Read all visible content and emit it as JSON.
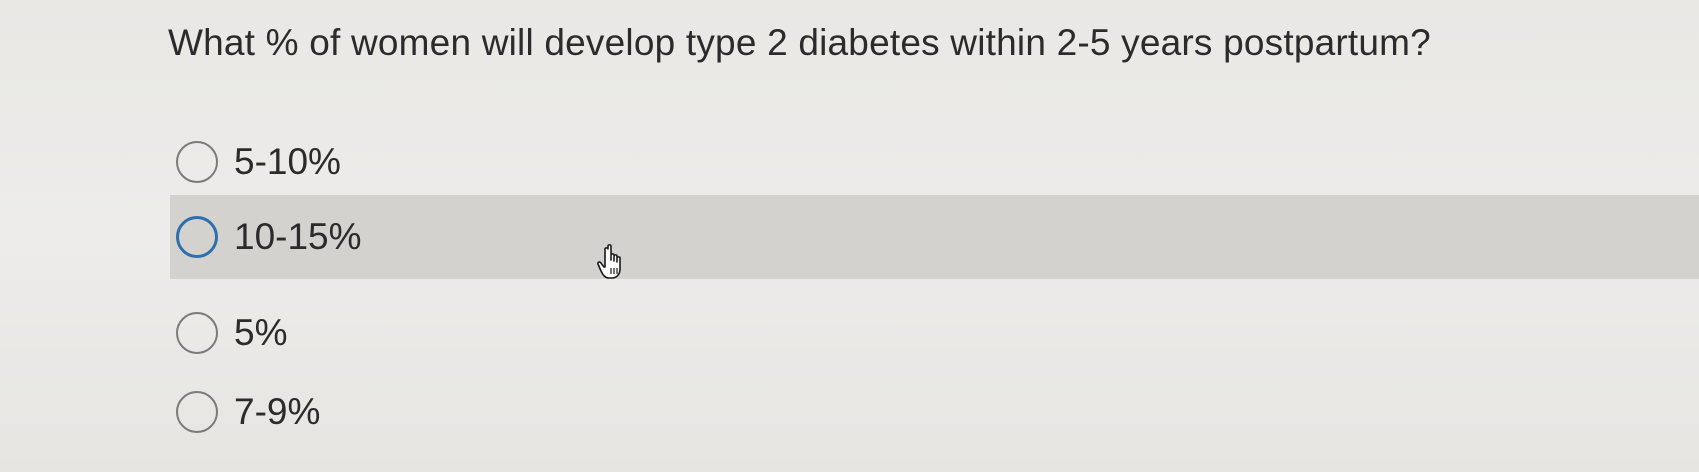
{
  "question": {
    "text": "What % of women will develop type 2 diabetes within 2-5 years postpartum?"
  },
  "options": [
    {
      "label": "5-10%",
      "selected": false,
      "hovered": false
    },
    {
      "label": "10-15%",
      "selected": false,
      "hovered": true
    },
    {
      "label": "5%",
      "selected": false,
      "hovered": false
    },
    {
      "label": "7-9%",
      "selected": false,
      "hovered": false
    }
  ],
  "colors": {
    "background": "#ecebe8",
    "hover_row": "#d3d2ce",
    "radio_border": "#7a7a7a",
    "radio_focus": "#2f6fae",
    "text": "#2b2b2b"
  },
  "cursor": {
    "icon": "hand-pointer-icon"
  }
}
